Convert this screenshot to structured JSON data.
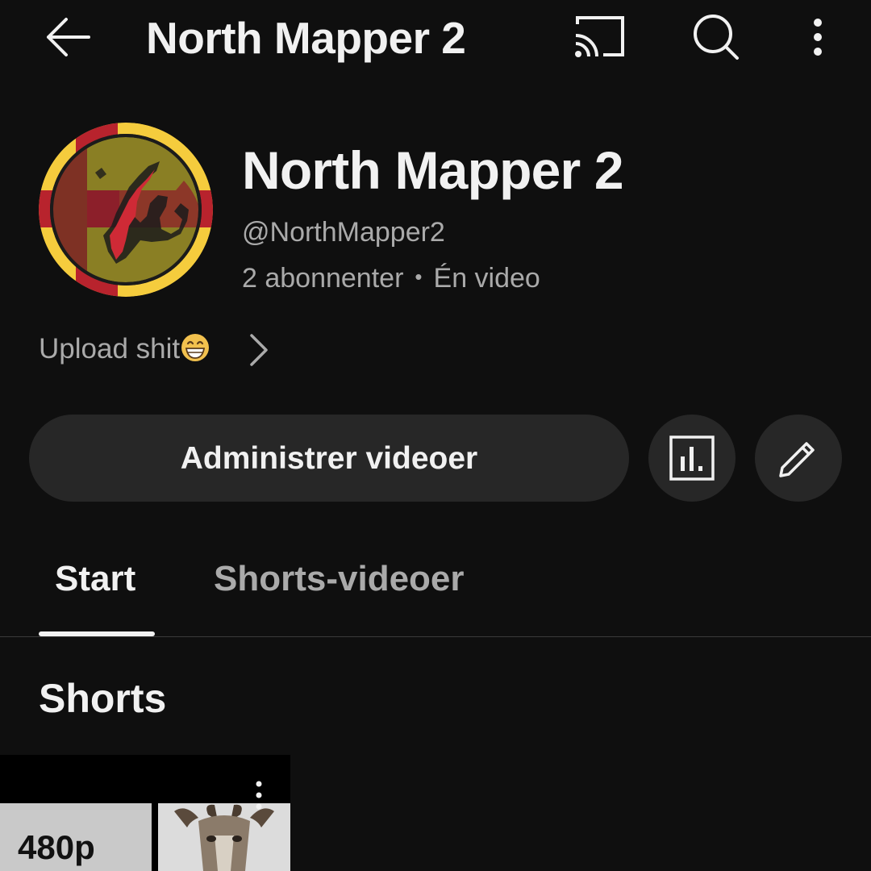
{
  "header": {
    "title": "North Mapper 2",
    "icons": [
      "arrow-left-icon",
      "cast-icon",
      "search-icon",
      "more-vertical-icon"
    ]
  },
  "channel": {
    "name": "North Mapper 2",
    "handle": "@NorthMapper2",
    "subscribers": "2 abonnenter",
    "separator": "•",
    "videos": "Én video",
    "description": "Upload shit",
    "description_emoji": "grinning-face-emoji"
  },
  "actions": {
    "manage_label": "Administrer videoer",
    "stats_icon": "analytics-icon",
    "edit_icon": "pencil-icon"
  },
  "tabs": [
    {
      "label": "Start",
      "selected": true
    },
    {
      "label": "Shorts-videoer",
      "selected": false
    }
  ],
  "shorts": {
    "section_title": "Shorts",
    "items": [
      {
        "thumbnail_text": "480p"
      }
    ]
  },
  "colors": {
    "background": "#0f0f0f",
    "button_background": "#272727",
    "primary_text": "#f1f1f1",
    "secondary_text": "#aaaaaa",
    "avatar_yellow": "#f5cc3d",
    "avatar_red": "#b8232d",
    "avatar_olive": "#8a7f24"
  }
}
